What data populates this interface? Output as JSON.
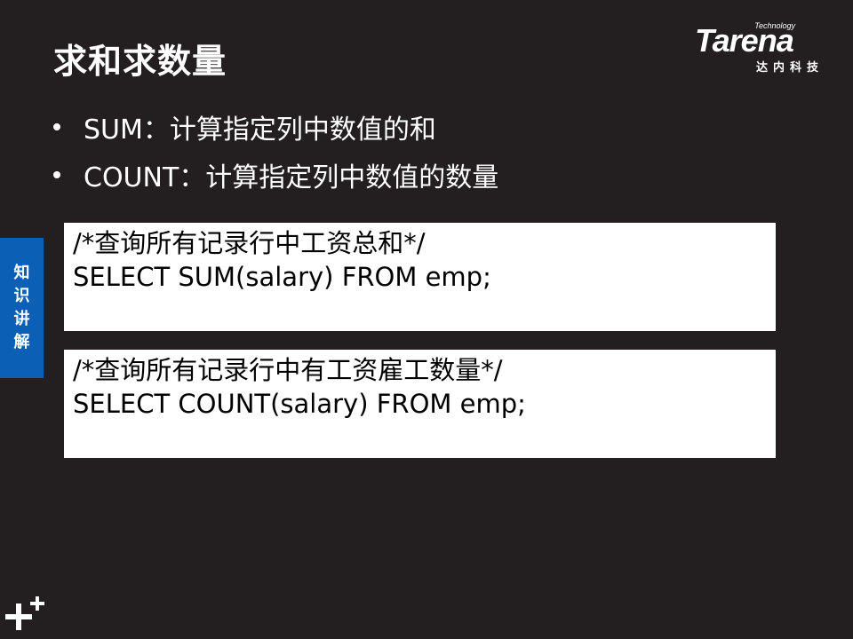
{
  "slide": {
    "title": "求和求数量",
    "bullets": [
      {
        "label": "SUM：计算指定列中数值的和"
      },
      {
        "label": "COUNT：计算指定列中数值的数量"
      }
    ],
    "side_tab": [
      "知",
      "识",
      "讲",
      "解"
    ],
    "code_blocks": [
      {
        "comment": "/*查询所有记录行中工资总和*/",
        "code": "SELECT SUM(salary) FROM emp;"
      },
      {
        "comment": "/*查询所有记录行中有工资雇工数量*/",
        "code": "SELECT COUNT(salary) FROM emp;"
      }
    ]
  },
  "logo": {
    "tagline": "Technology",
    "brand": "Tarena",
    "chinese": "达内科技"
  },
  "colors": {
    "background": "#231f20",
    "side_tab": "#0b5fb4",
    "code_box": "#ffffff"
  },
  "icons": [
    "plus-icon"
  ]
}
